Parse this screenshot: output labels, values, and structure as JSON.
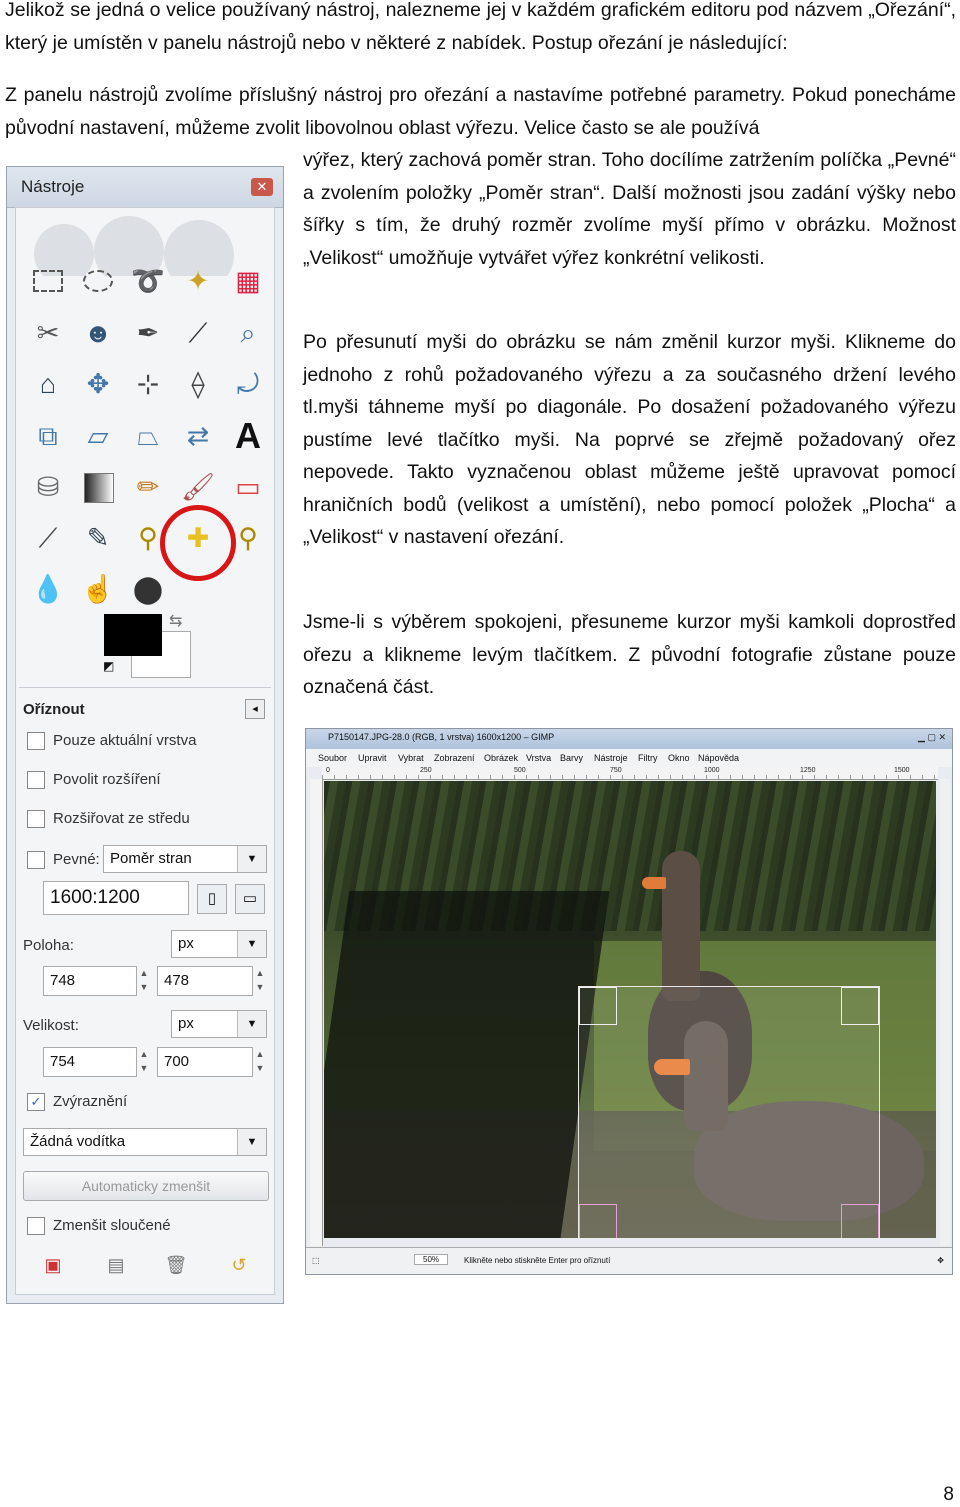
{
  "text": {
    "p1": "Jelikož se jedná o velice používaný nástroj, nalezneme jej v každém grafickém editoru pod názvem „Ořezání“, který je umístěn v panelu nástrojů nebo v některé z nabídek. Postup ořezání je následující:",
    "p2a": "Z panelu nástrojů zvolíme příslušný nástroj pro ořezání a nastavíme potřebné parametry. Pokud ponecháme původní nastavení, můžeme zvolit libovolnou oblast výřezu. Velice často se ale používá",
    "p2b": "výřez, který zachová poměr stran. Toho docílíme zatržením políčka „Pevné“ a zvolením položky „Poměr stran“. Další možnosti jsou zadání výšky nebo šířky s tím, že druhý rozměr zvolíme myší přímo v obrázku. Možnost „Velikost“ umožňuje vytvářet výřez konkrétní velikosti.",
    "p3": "Po přesunutí myši do obrázku se nám změnil kurzor myši. Klikneme do jednoho z rohů požadovaného výřezu a za současného držení levého tl.myši táhneme myší po diagonále. Po dosažení požadovaného výřezu pustíme levé tlačítko myši. Na poprvé se zřejmě požadovaný ořez nepovede. Takto vyznačenou oblast můžeme ještě upravovat pomocí hraničních bodů (velikost a umístění), nebo pomocí položek „Plocha“ a „Velikost“ v nastavení ořezání.",
    "p4": "Jsme-li s výběrem spokojeni, přesuneme kurzor myši kamkoli doprostřed ořezu a klikneme levým tlačítkem. Z původní fotografie zůstane pouze označená část.",
    "page_number": "8"
  },
  "toolbox": {
    "title": "Nástroje",
    "options_title": "Oříznout",
    "current_layer_label": "Pouze aktuální vrstva",
    "allow_grow_label": "Povolit rozšíření",
    "expand_center_label": "Rozšiřovat ze středu",
    "fixed_label": "Pevné:",
    "fixed_mode": "Poměr stran",
    "ratio_value": "1600:1200",
    "position_label": "Poloha:",
    "position_unit": "px",
    "position_x": "748",
    "position_y": "478",
    "size_label": "Velikost:",
    "size_unit": "px",
    "size_w": "754",
    "size_h": "700",
    "highlight_label": "Zvýraznění",
    "highlight_checked": true,
    "guides_value": "Žádná vodítka",
    "autoshrink_label": "Automaticky zmenšit",
    "shrink_merged_label": "Zmenšit sloučené"
  },
  "image_window": {
    "title": "P7150147.JPG-28.0 (RGB, 1 vrstva) 1600x1200 – GIMP",
    "menu": [
      "Soubor",
      "Upravit",
      "Vybrat",
      "Zobrazení",
      "Obrázek",
      "Vrstva",
      "Barvy",
      "Nástroje",
      "Filtry",
      "Okno",
      "Nápověda"
    ],
    "ruler_ticks": [
      "0",
      "250",
      "500",
      "750",
      "1000",
      "1250",
      "1500"
    ],
    "zoom": "50%",
    "status": "Klikněte nebo stiskněte Enter pro oříznutí"
  }
}
